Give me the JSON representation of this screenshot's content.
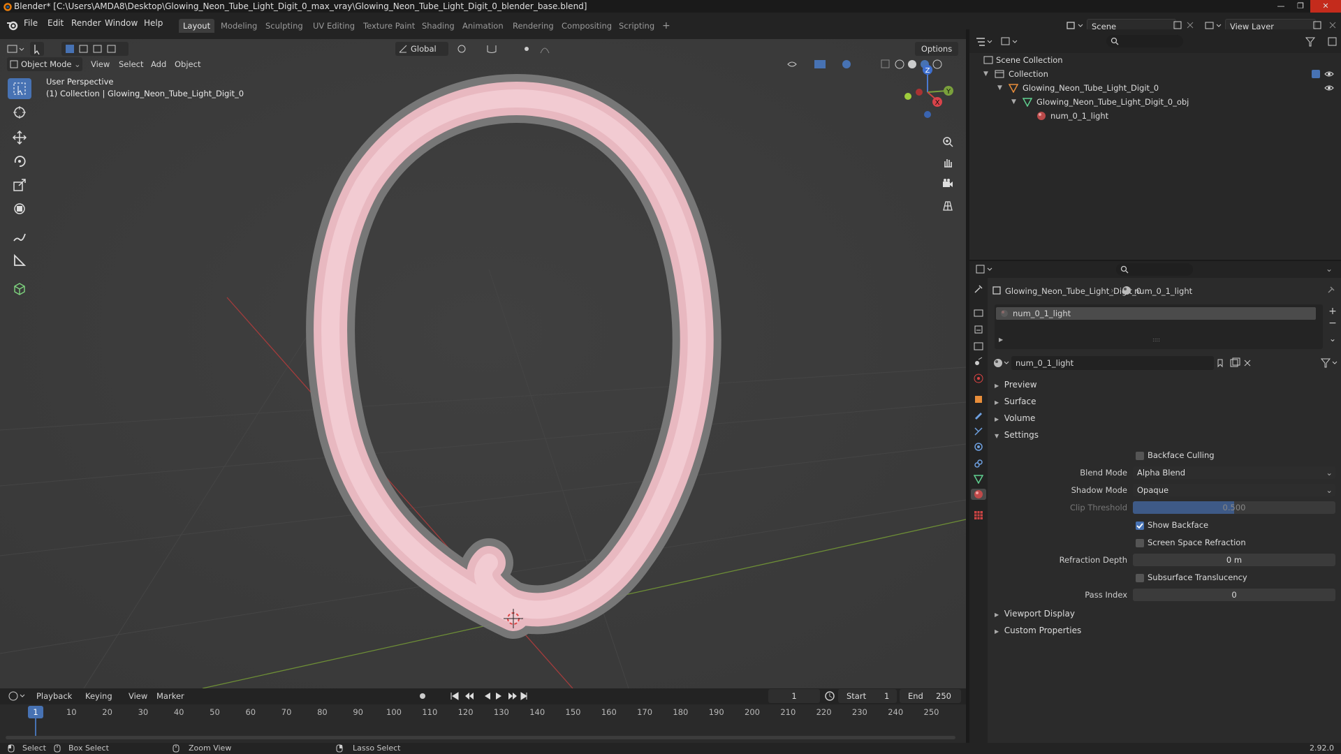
{
  "window": {
    "title": "Blender* [C:\\Users\\AMDA8\\Desktop\\Glowing_Neon_Tube_Light_Digit_0_max_vray\\Glowing_Neon_Tube_Light_Digit_0_blender_base.blend]",
    "minimize": "—",
    "maximize": "❐",
    "close": "✕"
  },
  "menu": {
    "file": "File",
    "edit": "Edit",
    "render": "Render",
    "window": "Window",
    "help": "Help"
  },
  "workspaces": [
    "Layout",
    "Modeling",
    "Sculpting",
    "UV Editing",
    "Texture Paint",
    "Shading",
    "Animation",
    "Rendering",
    "Compositing",
    "Scripting"
  ],
  "workspace_add": "+",
  "scene": {
    "name": "Scene",
    "view_layer": "View Layer"
  },
  "viewport": {
    "mode": "Object Mode",
    "menus": [
      "View",
      "Select",
      "Add",
      "Object"
    ],
    "transform_orientation": "Global",
    "options": "Options",
    "overlay_title": "User Perspective",
    "overlay_sub": "(1) Collection | Glowing_Neon_Tube_Light_Digit_0",
    "gizmo": {
      "x": "X",
      "y": "Y",
      "z": "Z"
    }
  },
  "timeline": {
    "menus": [
      "Playback",
      "Keying",
      "View",
      "Marker"
    ],
    "current_frame": "1",
    "start_label": "Start",
    "start": "1",
    "end_label": "End",
    "end": "250",
    "ticks": [
      "1",
      "10",
      "20",
      "30",
      "40",
      "50",
      "60",
      "70",
      "80",
      "90",
      "100",
      "110",
      "120",
      "130",
      "140",
      "150",
      "160",
      "170",
      "180",
      "190",
      "200",
      "210",
      "220",
      "230",
      "240",
      "250"
    ]
  },
  "status": {
    "select": "Select",
    "box_select": "Box Select",
    "zoom_view": "Zoom View",
    "lasso_select": "Lasso Select",
    "version": "2.92.0"
  },
  "outliner": {
    "scene_collection": "Scene Collection",
    "collection": "Collection",
    "object": "Glowing_Neon_Tube_Light_Digit_0",
    "mesh": "Glowing_Neon_Tube_Light_Digit_0_obj",
    "material": "num_0_1_light"
  },
  "properties": {
    "breadcrumb_object": "Glowing_Neon_Tube_Light_Digit_0",
    "breadcrumb_material": "num_0_1_light",
    "slot": "num_0_1_light",
    "material_name": "num_0_1_light",
    "panels": {
      "preview": "Preview",
      "surface": "Surface",
      "volume": "Volume",
      "settings": "Settings",
      "viewport_display": "Viewport Display",
      "custom_properties": "Custom Properties"
    },
    "settings": {
      "backface_culling": "Backface Culling",
      "blend_mode_label": "Blend Mode",
      "blend_mode": "Alpha Blend",
      "shadow_mode_label": "Shadow Mode",
      "shadow_mode": "Opaque",
      "clip_threshold_label": "Clip Threshold",
      "clip_threshold": "0.500",
      "show_backface": "Show Backface",
      "screen_space_refraction": "Screen Space Refraction",
      "refraction_depth_label": "Refraction Depth",
      "refraction_depth": "0 m",
      "subsurface_translucency": "Subsurface Translucency",
      "pass_index_label": "Pass Index",
      "pass_index": "0"
    }
  },
  "colors": {
    "accent": "#4772b3",
    "neon_pink": "#f0c4cc",
    "tube_gray": "#8a8a8a",
    "x_axis": "#b43c3c",
    "y_axis": "#7aa03c"
  }
}
